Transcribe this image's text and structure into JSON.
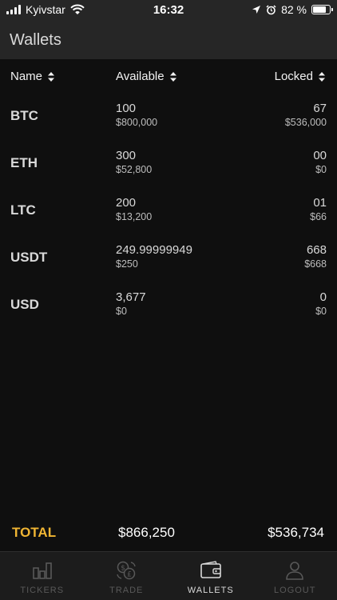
{
  "status_bar": {
    "carrier": "Kyivstar",
    "time": "16:32",
    "battery_text": "82 %",
    "battery_level": 0.82
  },
  "header": {
    "title": "Wallets"
  },
  "columns": {
    "name": "Name",
    "available": "Available",
    "locked": "Locked"
  },
  "wallets": [
    {
      "asset": "BTC",
      "available": "100",
      "available_fiat": "$800,000",
      "locked": "67",
      "locked_fiat": "$536,000"
    },
    {
      "asset": "ETH",
      "available": "300",
      "available_fiat": "$52,800",
      "locked": "00",
      "locked_fiat": "$0"
    },
    {
      "asset": "LTC",
      "available": "200",
      "available_fiat": "$13,200",
      "locked": "01",
      "locked_fiat": "$66"
    },
    {
      "asset": "USDT",
      "available": "249.99999949",
      "available_fiat": "$250",
      "locked": "668",
      "locked_fiat": "$668"
    },
    {
      "asset": "USD",
      "available": "3,677",
      "available_fiat": "$0",
      "locked": "0",
      "locked_fiat": "$0"
    }
  ],
  "total": {
    "label": "TOTAL",
    "available": "$866,250",
    "locked": "$536,734"
  },
  "tabs": [
    {
      "label": "TICKERS",
      "icon": "bar-chart-icon",
      "active": false
    },
    {
      "label": "TRADE",
      "icon": "currency-exchange-icon",
      "active": false
    },
    {
      "label": "WALLETS",
      "icon": "wallet-icon",
      "active": true
    },
    {
      "label": "LOGOUT",
      "icon": "user-icon",
      "active": false
    }
  ],
  "colors": {
    "background": "#0f0f0f",
    "header": "#262626",
    "total_accent": "#f0b533",
    "tab_active": "#d9d9d9",
    "tab_inactive": "#595959"
  }
}
